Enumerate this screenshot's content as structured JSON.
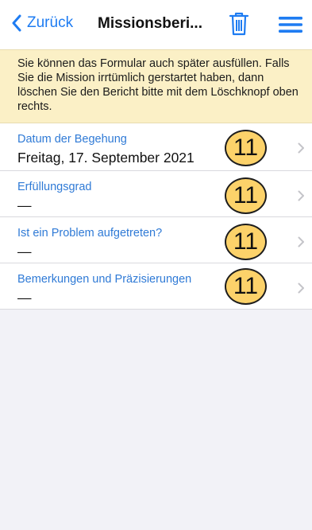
{
  "navbar": {
    "back_label": "Zurück",
    "title": "Missionsberi...",
    "icons": {
      "back": "chevron-left-icon",
      "delete": "trash-icon",
      "menu": "hamburger-menu-icon"
    },
    "accent_color": "#1e7cf2"
  },
  "banner": {
    "text": "Sie können das Formular auch später ausfüllen. Falls Sie die Mission irrtümlich gerstartet haben, dann löschen Sie den Bericht bitte mit dem Löschknopf oben rechts.",
    "background_color": "#fbf0c6"
  },
  "form": {
    "rows": [
      {
        "label": "Datum der Begehung",
        "value": "Freitag, 17. September 2021",
        "badge": "11"
      },
      {
        "label": "Erfüllungsgrad",
        "value": "—",
        "badge": "11"
      },
      {
        "label": "Ist ein Problem aufgetreten?",
        "value": "—",
        "badge": "11"
      },
      {
        "label": "Bemerkungen und Präzisierungen",
        "value": "—",
        "badge": "11"
      }
    ]
  }
}
